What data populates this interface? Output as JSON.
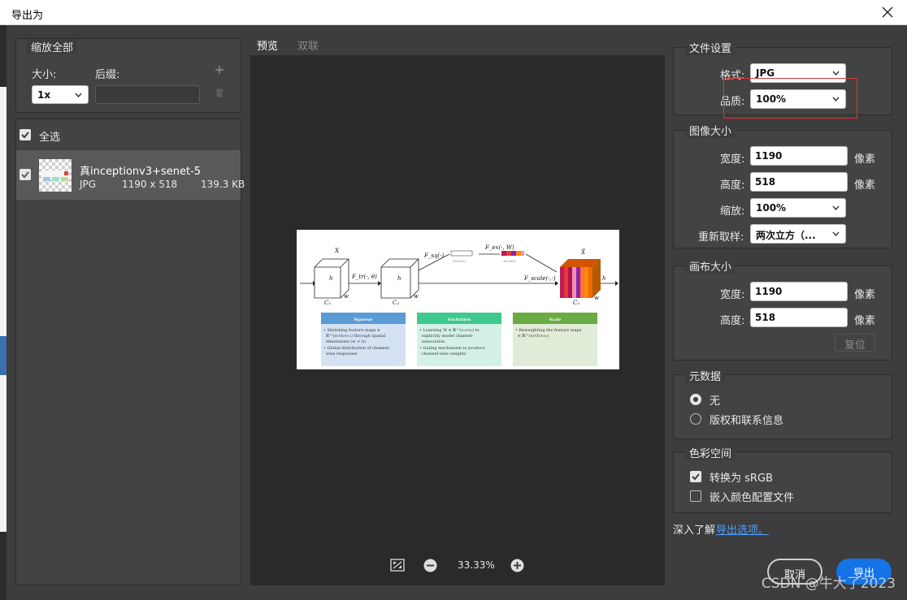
{
  "window": {
    "title": "导出为"
  },
  "left": {
    "scale_all_title": "缩放全部",
    "size_label": "大小:",
    "suffix_label": "后缀:",
    "size_value": "1x",
    "suffix_value": "",
    "select_all_label": "全选",
    "asset": {
      "name": "真inceptionv3+senet-5",
      "format": "JPG",
      "dimensions": "1190 x 518",
      "filesize": "139.3 KB"
    }
  },
  "preview": {
    "tab_preview": "预览",
    "tab_dual": "双联",
    "zoom_level": "33.33%",
    "figure": {
      "x_label": "X",
      "xtilde_label": "X̃",
      "h": "h",
      "w": "w",
      "c1": "C₁",
      "c2": "C₂",
      "ftr": "F_tr(·, θ)",
      "fsq": "F_sq(·)",
      "fex": "F_ex(·, W)",
      "fscale": "F_scale(·,·)",
      "size1": "1×1×C₂",
      "size2": "1×1×C₂",
      "box_squeeze_title": "Squeeze",
      "box_squeeze_b1": "• Shrinking feature maps ∈",
      "box_squeeze_b2": "ℝ^(w×h×c₂) through spatial",
      "box_squeeze_b3": "dimensions (w × h)",
      "box_squeeze_b4": "• Global distribution of channel-",
      "box_squeeze_b5": "wise responses",
      "box_excitation_title": "Excitation",
      "box_excitation_b1": "• Learning W ∈ ℝ^(c₂×c₂) to",
      "box_excitation_b2": "explicitly model channel-",
      "box_excitation_b3": "association",
      "box_excitation_b4": "• Gating mechanism to produce",
      "box_excitation_b5": "channel-wise weights",
      "box_scale_title": "Scale",
      "box_scale_b1": "• Reweighting the feature maps",
      "box_scale_b2": "∈ ℝ^(w×h×c₂)"
    }
  },
  "right": {
    "file_settings_title": "文件设置",
    "format_label": "格式:",
    "format_value": "JPG",
    "quality_label": "品质:",
    "quality_value": "100%",
    "image_size_title": "图像大小",
    "width_label": "宽度:",
    "width_value": "1190",
    "height_label": "高度:",
    "height_value": "518",
    "pixel_unit": "像素",
    "scale_label": "缩放:",
    "scale_value": "100%",
    "resample_label": "重新取样:",
    "resample_value": "两次立方（...",
    "canvas_size_title": "画布大小",
    "canvas_width_label": "宽度:",
    "canvas_width_value": "1190",
    "canvas_height_label": "高度:",
    "canvas_height_value": "518",
    "reset_label": "复位",
    "metadata_title": "元数据",
    "metadata_none": "无",
    "metadata_copyright": "版权和联系信息",
    "color_space_title": "色彩空间",
    "convert_srgb": "转换为 sRGB",
    "embed_profile": "嵌入颜色配置文件",
    "learn_more": "深入了解",
    "export_options_link": "导出选项。"
  },
  "buttons": {
    "cancel": "取消",
    "export": "导出"
  },
  "watermark": "CSDN @牛大了2023",
  "colors": {
    "accent": "#1473e6",
    "highlight_box": "#d83a3a",
    "link": "#4a9fff"
  }
}
